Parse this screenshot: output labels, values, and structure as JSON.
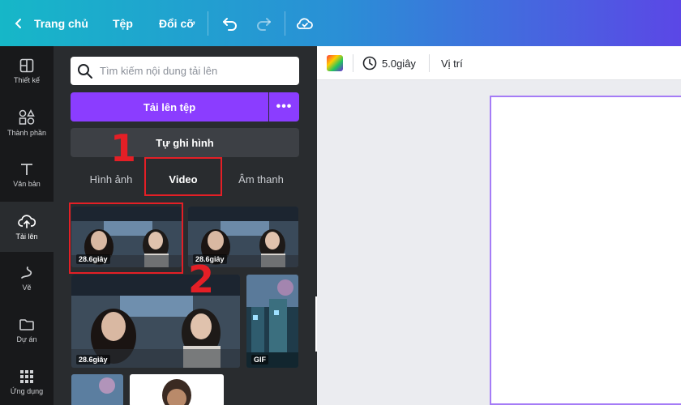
{
  "topbar": {
    "home_label": "Trang chủ",
    "file_label": "Tệp",
    "resize_label": "Đổi cỡ"
  },
  "rail": {
    "items": [
      {
        "label": "Thiết kế",
        "icon": "layout-icon"
      },
      {
        "label": "Thành phần",
        "icon": "elements-icon"
      },
      {
        "label": "Văn bản",
        "icon": "text-icon"
      },
      {
        "label": "Tải lên",
        "icon": "upload-cloud-icon"
      },
      {
        "label": "Vẽ",
        "icon": "draw-icon"
      },
      {
        "label": "Dự án",
        "icon": "folder-icon"
      },
      {
        "label": "Ứng dụng",
        "icon": "apps-grid-icon"
      }
    ]
  },
  "panel": {
    "search_placeholder": "Tìm kiếm nội dung tải lên",
    "upload_label": "Tải lên tệp",
    "more_label": "•••",
    "record_label": "Tự ghi hình",
    "tabs": [
      "Hình ảnh",
      "Video",
      "Âm thanh"
    ],
    "active_tab": "Video",
    "videos": [
      {
        "duration": "28.6giây"
      },
      {
        "duration": "28.6giây"
      },
      {
        "duration": "28.6giây"
      },
      {
        "duration": "GIF"
      }
    ]
  },
  "editor_toolbar": {
    "duration_label": "5.0giây",
    "position_label": "Vị trí"
  },
  "annotations": {
    "step1": "1",
    "step2": "2"
  },
  "colors": {
    "accent_purple": "#8b3dff",
    "annotation_red": "#e41f26",
    "panel_bg": "#292c2f",
    "rail_bg": "#18191b"
  }
}
